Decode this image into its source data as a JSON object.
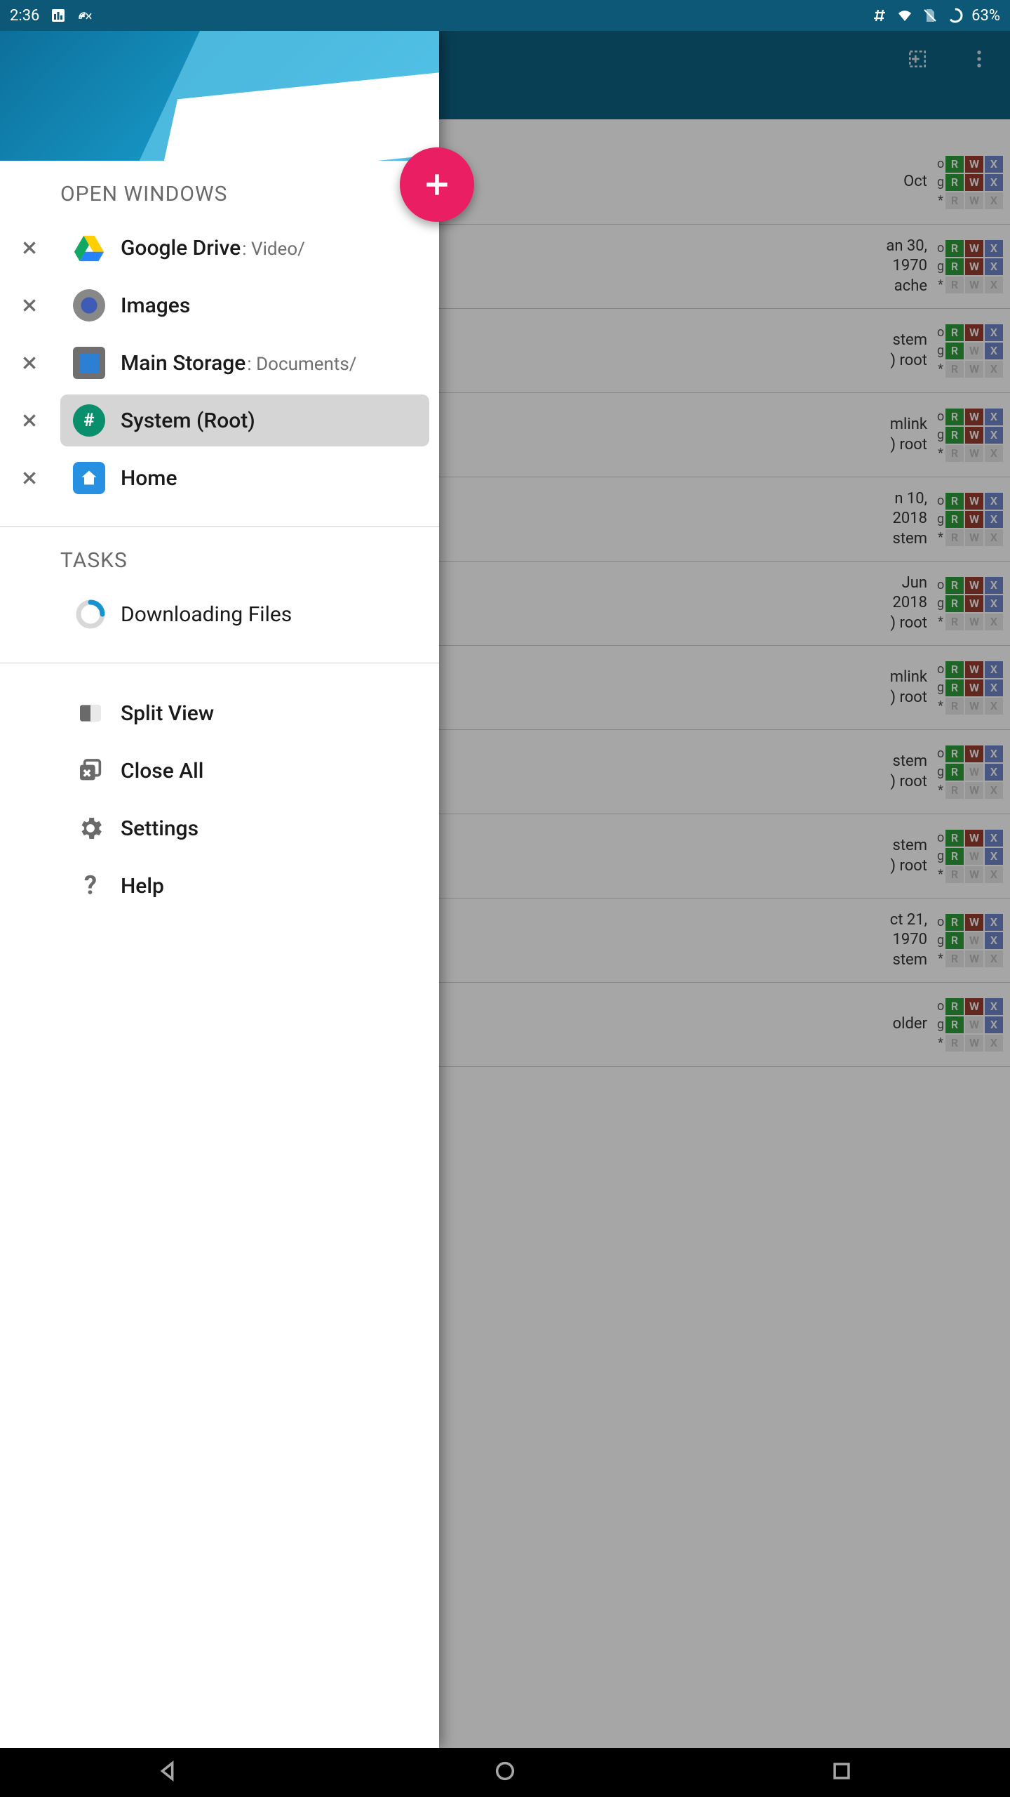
{
  "status": {
    "time": "2:36",
    "battery": "63%"
  },
  "drawer": {
    "open_windows_title": "OPEN WINDOWS",
    "tasks_title": "TASKS",
    "windows": [
      {
        "name": "Google Drive",
        "path": ": Video/",
        "icon": "gdrive",
        "active": false
      },
      {
        "name": "Images",
        "path": "",
        "icon": "images",
        "active": false
      },
      {
        "name": "Main Storage",
        "path": ": Documents/",
        "icon": "storage",
        "active": false
      },
      {
        "name": "System (Root)",
        "path": "",
        "icon": "sysroot",
        "active": true
      },
      {
        "name": "Home",
        "path": "",
        "icon": "home",
        "active": false
      }
    ],
    "tasks": [
      {
        "label": "Downloading Files"
      }
    ],
    "menu": {
      "split_view": "Split View",
      "close_all": "Close All",
      "settings": "Settings",
      "help": "Help"
    }
  },
  "bg_header": {
    "select_icon": "select",
    "overflow": "⋮"
  },
  "bg_rows": [
    {
      "l1": "Oct",
      "l2": "",
      "l3": "",
      "perm": [
        [
          1,
          1,
          1
        ],
        [
          1,
          1,
          1
        ],
        [
          0,
          0,
          0
        ]
      ]
    },
    {
      "l1": "an 30,",
      "l2": "1970",
      "l3": "ache",
      "perm": [
        [
          1,
          1,
          1
        ],
        [
          1,
          1,
          1
        ],
        [
          0,
          0,
          0
        ]
      ]
    },
    {
      "l1": "",
      "l2": "stem",
      "l3": ") root",
      "perm": [
        [
          1,
          1,
          1
        ],
        [
          1,
          0,
          1
        ],
        [
          0,
          0,
          0
        ]
      ]
    },
    {
      "l1": "",
      "l2": "mlink",
      "l3": ") root",
      "perm": [
        [
          1,
          1,
          1
        ],
        [
          1,
          1,
          1
        ],
        [
          0,
          0,
          0
        ]
      ]
    },
    {
      "l1": "n 10,",
      "l2": "2018",
      "l3": "stem",
      "perm": [
        [
          1,
          1,
          1
        ],
        [
          1,
          1,
          1
        ],
        [
          0,
          0,
          0
        ]
      ]
    },
    {
      "l1": "Jun",
      "l2": "2018",
      "l3": ") root",
      "perm": [
        [
          1,
          1,
          1
        ],
        [
          1,
          1,
          1
        ],
        [
          0,
          0,
          0
        ]
      ]
    },
    {
      "l1": "",
      "l2": "mlink",
      "l3": ") root",
      "perm": [
        [
          1,
          1,
          1
        ],
        [
          1,
          1,
          1
        ],
        [
          0,
          0,
          0
        ]
      ]
    },
    {
      "l1": "",
      "l2": "stem",
      "l3": ") root",
      "perm": [
        [
          1,
          1,
          1
        ],
        [
          1,
          0,
          1
        ],
        [
          0,
          0,
          0
        ]
      ]
    },
    {
      "l1": "",
      "l2": "stem",
      "l3": ") root",
      "perm": [
        [
          1,
          1,
          1
        ],
        [
          1,
          0,
          1
        ],
        [
          0,
          0,
          0
        ]
      ]
    },
    {
      "l1": "ct 21,",
      "l2": "1970",
      "l3": "stem",
      "perm": [
        [
          1,
          1,
          1
        ],
        [
          1,
          0,
          1
        ],
        [
          0,
          0,
          0
        ]
      ]
    },
    {
      "l1": "",
      "l2": "older",
      "l3": "",
      "perm": [
        [
          1,
          1,
          1
        ],
        [
          1,
          0,
          1
        ],
        [
          0,
          0,
          0
        ]
      ]
    }
  ]
}
